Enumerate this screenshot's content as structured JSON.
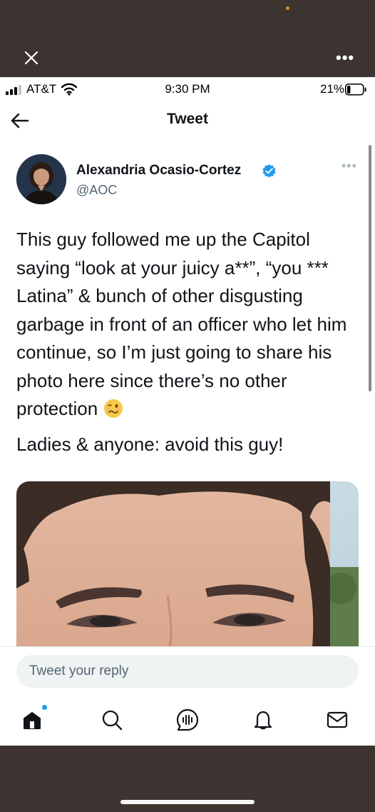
{
  "chrome": {
    "close_icon": "close-icon",
    "more_icon": "more-icon",
    "more_text": "•••"
  },
  "status_bar": {
    "carrier": "AT&T",
    "time": "9:30 PM",
    "battery_percent": "21%",
    "battery_level": 0.21
  },
  "nav": {
    "title": "Tweet",
    "back_icon": "back-arrow-icon"
  },
  "tweet": {
    "author_name": "Alexandria Ocasio-Cortez",
    "author_handle": "@AOC",
    "verified": true,
    "more_text": "•••",
    "text_line_1": "This guy followed me up the Capitol saying “look at your juicy a**”, “you *** Latina” & bunch of other disgusting garbage in front of an officer who let him continue, so I’m just going to share his photo here since there’s no other protection",
    "emoji": "woozy-face-emoji",
    "text_line_2": "Ladies & anyone: avoid this guy!"
  },
  "reply": {
    "placeholder": "Tweet your reply"
  },
  "tabs": [
    {
      "name": "home",
      "icon": "home-icon",
      "has_notification": true
    },
    {
      "name": "search",
      "icon": "search-icon"
    },
    {
      "name": "spaces",
      "icon": "spaces-icon"
    },
    {
      "name": "notifications",
      "icon": "bell-icon"
    },
    {
      "name": "messages",
      "icon": "mail-icon"
    }
  ],
  "colors": {
    "accent": "#1d9bf0",
    "outer_background": "#3d3431",
    "handle_gray": "#536471"
  }
}
